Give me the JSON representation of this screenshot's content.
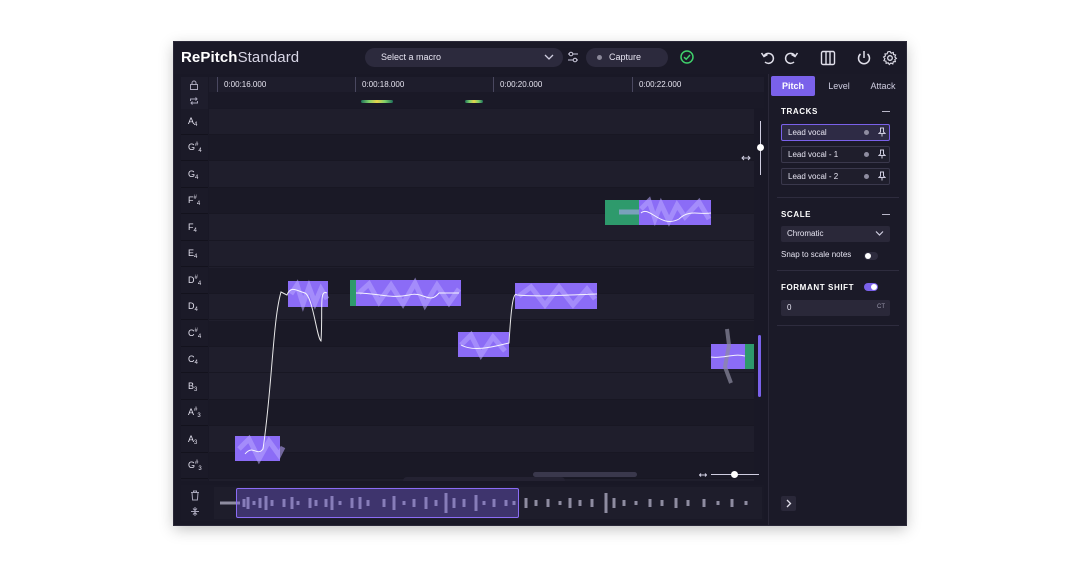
{
  "app": {
    "name": "RePitch",
    "edition": "Standard"
  },
  "macro": {
    "placeholder": "Select a macro"
  },
  "capture": {
    "label": "Capture"
  },
  "ruler": {
    "times": [
      "0:00:16.000",
      "0:00:18.000",
      "0:00:20.000",
      "0:00:22.000"
    ]
  },
  "keys": [
    {
      "note": "A",
      "acc": "",
      "oct": "4"
    },
    {
      "note": "G",
      "acc": "#",
      "oct": "4"
    },
    {
      "note": "G",
      "acc": "",
      "oct": "4"
    },
    {
      "note": "F",
      "acc": "#",
      "oct": "4"
    },
    {
      "note": "F",
      "acc": "",
      "oct": "4"
    },
    {
      "note": "E",
      "acc": "",
      "oct": "4"
    },
    {
      "note": "D",
      "acc": "#",
      "oct": "4"
    },
    {
      "note": "D",
      "acc": "",
      "oct": "4"
    },
    {
      "note": "C",
      "acc": "#",
      "oct": "4"
    },
    {
      "note": "C",
      "acc": "",
      "oct": "4"
    },
    {
      "note": "B",
      "acc": "",
      "oct": "3"
    },
    {
      "note": "A",
      "acc": "#",
      "oct": "3"
    },
    {
      "note": "A",
      "acc": "",
      "oct": "3"
    },
    {
      "note": "G",
      "acc": "#",
      "oct": "3"
    }
  ],
  "tabs": [
    "Pitch",
    "Level",
    "Attack"
  ],
  "active_tab": "Pitch",
  "tracks_section": {
    "title": "TRACKS",
    "items": [
      "Lead vocal",
      "Lead vocal - 1",
      "Lead vocal - 2"
    ],
    "selected": "Lead vocal"
  },
  "scale_section": {
    "title": "SCALE",
    "value": "Chromatic",
    "snap_label": "Snap to scale notes",
    "snap_on": false
  },
  "formant_section": {
    "title": "FORMANT SHIFT",
    "enabled": true,
    "value": "0",
    "unit": "CT"
  },
  "colors": {
    "accent": "#7a61ea",
    "note_fill": "#8b6cf6",
    "unvoiced": "#2e9a6c",
    "ok_green": "#3fcf6b"
  },
  "icons": [
    "chevron-down-icon",
    "sliders-icon",
    "check-circle-icon",
    "undo-icon",
    "redo-icon",
    "panels-icon",
    "power-icon",
    "gear-icon",
    "lock-icon",
    "loop-icon",
    "trash-icon",
    "split-icon",
    "pointer-tool-icon",
    "pitch-tool-icon",
    "pencil-tool-icon",
    "eraser-tool-icon",
    "scissors-tool-icon",
    "waveform-tool-icon",
    "zoom-tool-icon",
    "drag-handle-icon",
    "pin-icon",
    "chevron-right-icon"
  ]
}
